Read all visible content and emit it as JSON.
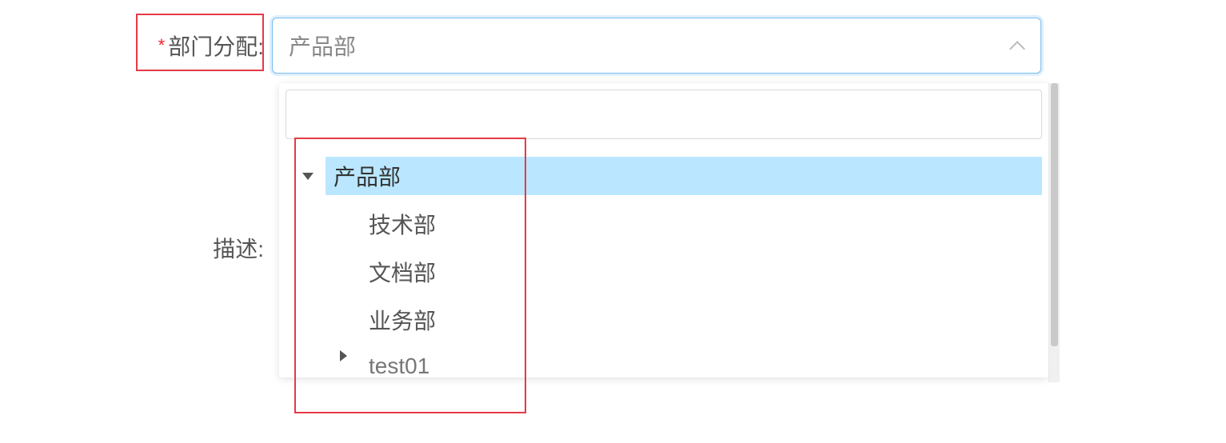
{
  "form": {
    "department": {
      "label": "部门分配:",
      "value": "产品部",
      "required": true
    },
    "description": {
      "label": "描述:"
    }
  },
  "dropdown": {
    "search_placeholder": "",
    "nodes": [
      {
        "label": "产品部",
        "expanded": true,
        "selected": true,
        "level": 0
      },
      {
        "label": "技术部",
        "expanded": false,
        "selected": false,
        "level": 1
      },
      {
        "label": "文档部",
        "expanded": false,
        "selected": false,
        "level": 1
      },
      {
        "label": "业务部",
        "expanded": false,
        "selected": false,
        "level": 1
      },
      {
        "label": "test01",
        "expanded": false,
        "selected": false,
        "level": 1,
        "hasChildren": true
      }
    ]
  }
}
